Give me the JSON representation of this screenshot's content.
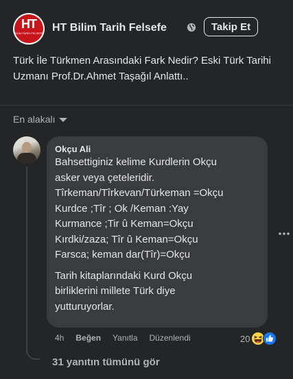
{
  "page": {
    "name": "HT Bilim Tarih Felsefe",
    "logo_text": "HT",
    "logo_subtext": "BİLİM TARİH FELSEFE",
    "follow_label": "Takip Et"
  },
  "post": {
    "text": "Türk İle Türkmen Arasındaki Fark Nedir? Eski Türk Tarihi Uzmanı Prof.Dr.Ahmet Taşağıl Anlattı.."
  },
  "sort": {
    "label": "En alakalı"
  },
  "comment": {
    "author": "Okçu Ali",
    "paragraph1": [
      "Bahsettiginiz kelime Kurdlerin Okçu",
      "asker veya çeteleridir.",
      "Tîrkeman/Tîrkevan/Türkeman =Okçu",
      "Kurdce ;Tîr ; Ok /Keman :Yay",
      "Kurmance ;Tir û Keman=Okçu",
      "Kırdki/zaza; Tîr û Keman=Okçu",
      "Farsca; keman dar(Tîr)=Okçu"
    ],
    "paragraph2": [
      "Tarih kitaplarındaki Kurd Okçu",
      "birliklerini millete Türk diye",
      "yutturuyorlar."
    ],
    "time": "4h",
    "like_label": "Beğen",
    "reply_label": "Yanıtla",
    "edited_label": "Düzenlendi",
    "reaction_count": "20",
    "reactions": [
      "haha-icon",
      "like-icon"
    ]
  },
  "replies": {
    "label": "31 yanıtın tümünü gör"
  },
  "colors": {
    "background": "#242526",
    "bubble": "#3a3b3c",
    "text": "#e4e6eb",
    "secondary": "#b0b3b8",
    "like_blue": "#1877f2",
    "logo_red": "#c8141b"
  }
}
